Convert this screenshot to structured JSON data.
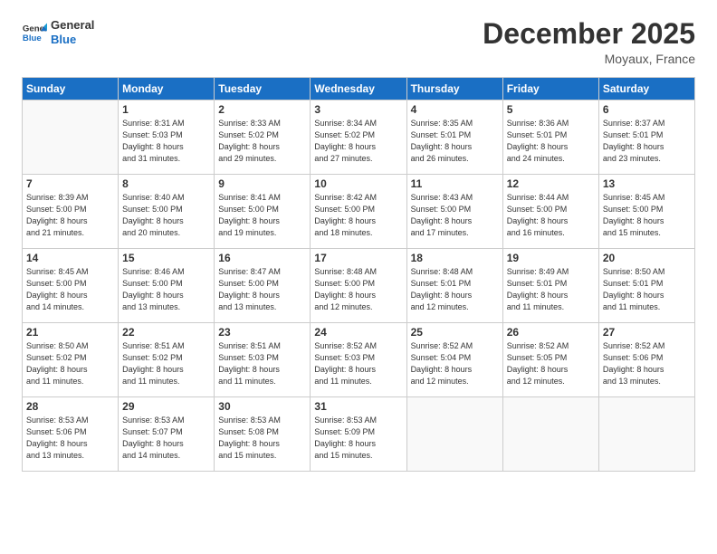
{
  "logo": {
    "line1": "General",
    "line2": "Blue"
  },
  "title": "December 2025",
  "location": "Moyaux, France",
  "days_header": [
    "Sunday",
    "Monday",
    "Tuesday",
    "Wednesday",
    "Thursday",
    "Friday",
    "Saturday"
  ],
  "weeks": [
    [
      {
        "num": "",
        "info": ""
      },
      {
        "num": "1",
        "info": "Sunrise: 8:31 AM\nSunset: 5:03 PM\nDaylight: 8 hours\nand 31 minutes."
      },
      {
        "num": "2",
        "info": "Sunrise: 8:33 AM\nSunset: 5:02 PM\nDaylight: 8 hours\nand 29 minutes."
      },
      {
        "num": "3",
        "info": "Sunrise: 8:34 AM\nSunset: 5:02 PM\nDaylight: 8 hours\nand 27 minutes."
      },
      {
        "num": "4",
        "info": "Sunrise: 8:35 AM\nSunset: 5:01 PM\nDaylight: 8 hours\nand 26 minutes."
      },
      {
        "num": "5",
        "info": "Sunrise: 8:36 AM\nSunset: 5:01 PM\nDaylight: 8 hours\nand 24 minutes."
      },
      {
        "num": "6",
        "info": "Sunrise: 8:37 AM\nSunset: 5:01 PM\nDaylight: 8 hours\nand 23 minutes."
      }
    ],
    [
      {
        "num": "7",
        "info": "Sunrise: 8:39 AM\nSunset: 5:00 PM\nDaylight: 8 hours\nand 21 minutes."
      },
      {
        "num": "8",
        "info": "Sunrise: 8:40 AM\nSunset: 5:00 PM\nDaylight: 8 hours\nand 20 minutes."
      },
      {
        "num": "9",
        "info": "Sunrise: 8:41 AM\nSunset: 5:00 PM\nDaylight: 8 hours\nand 19 minutes."
      },
      {
        "num": "10",
        "info": "Sunrise: 8:42 AM\nSunset: 5:00 PM\nDaylight: 8 hours\nand 18 minutes."
      },
      {
        "num": "11",
        "info": "Sunrise: 8:43 AM\nSunset: 5:00 PM\nDaylight: 8 hours\nand 17 minutes."
      },
      {
        "num": "12",
        "info": "Sunrise: 8:44 AM\nSunset: 5:00 PM\nDaylight: 8 hours\nand 16 minutes."
      },
      {
        "num": "13",
        "info": "Sunrise: 8:45 AM\nSunset: 5:00 PM\nDaylight: 8 hours\nand 15 minutes."
      }
    ],
    [
      {
        "num": "14",
        "info": "Sunrise: 8:45 AM\nSunset: 5:00 PM\nDaylight: 8 hours\nand 14 minutes."
      },
      {
        "num": "15",
        "info": "Sunrise: 8:46 AM\nSunset: 5:00 PM\nDaylight: 8 hours\nand 13 minutes."
      },
      {
        "num": "16",
        "info": "Sunrise: 8:47 AM\nSunset: 5:00 PM\nDaylight: 8 hours\nand 13 minutes."
      },
      {
        "num": "17",
        "info": "Sunrise: 8:48 AM\nSunset: 5:00 PM\nDaylight: 8 hours\nand 12 minutes."
      },
      {
        "num": "18",
        "info": "Sunrise: 8:48 AM\nSunset: 5:01 PM\nDaylight: 8 hours\nand 12 minutes."
      },
      {
        "num": "19",
        "info": "Sunrise: 8:49 AM\nSunset: 5:01 PM\nDaylight: 8 hours\nand 11 minutes."
      },
      {
        "num": "20",
        "info": "Sunrise: 8:50 AM\nSunset: 5:01 PM\nDaylight: 8 hours\nand 11 minutes."
      }
    ],
    [
      {
        "num": "21",
        "info": "Sunrise: 8:50 AM\nSunset: 5:02 PM\nDaylight: 8 hours\nand 11 minutes."
      },
      {
        "num": "22",
        "info": "Sunrise: 8:51 AM\nSunset: 5:02 PM\nDaylight: 8 hours\nand 11 minutes."
      },
      {
        "num": "23",
        "info": "Sunrise: 8:51 AM\nSunset: 5:03 PM\nDaylight: 8 hours\nand 11 minutes."
      },
      {
        "num": "24",
        "info": "Sunrise: 8:52 AM\nSunset: 5:03 PM\nDaylight: 8 hours\nand 11 minutes."
      },
      {
        "num": "25",
        "info": "Sunrise: 8:52 AM\nSunset: 5:04 PM\nDaylight: 8 hours\nand 12 minutes."
      },
      {
        "num": "26",
        "info": "Sunrise: 8:52 AM\nSunset: 5:05 PM\nDaylight: 8 hours\nand 12 minutes."
      },
      {
        "num": "27",
        "info": "Sunrise: 8:52 AM\nSunset: 5:06 PM\nDaylight: 8 hours\nand 13 minutes."
      }
    ],
    [
      {
        "num": "28",
        "info": "Sunrise: 8:53 AM\nSunset: 5:06 PM\nDaylight: 8 hours\nand 13 minutes."
      },
      {
        "num": "29",
        "info": "Sunrise: 8:53 AM\nSunset: 5:07 PM\nDaylight: 8 hours\nand 14 minutes."
      },
      {
        "num": "30",
        "info": "Sunrise: 8:53 AM\nSunset: 5:08 PM\nDaylight: 8 hours\nand 15 minutes."
      },
      {
        "num": "31",
        "info": "Sunrise: 8:53 AM\nSunset: 5:09 PM\nDaylight: 8 hours\nand 15 minutes."
      },
      {
        "num": "",
        "info": ""
      },
      {
        "num": "",
        "info": ""
      },
      {
        "num": "",
        "info": ""
      }
    ]
  ]
}
